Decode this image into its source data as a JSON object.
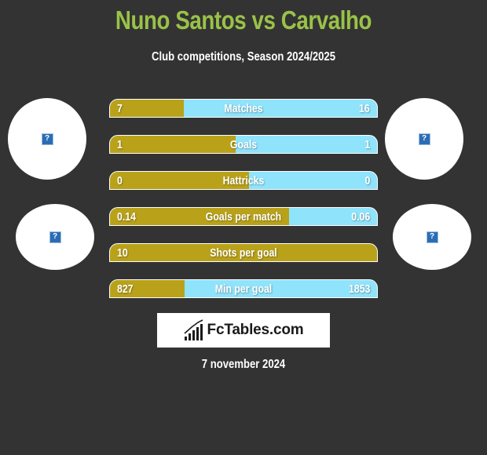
{
  "header": {
    "title": "Nuno Santos vs Carvalho",
    "subtitle": "Club competitions, Season 2024/2025"
  },
  "players": {
    "left": {
      "name": "Nuno Santos",
      "photo_icon": "broken-image-icon",
      "club_icon": "broken-image-icon"
    },
    "right": {
      "name": "Carvalho",
      "photo_icon": "broken-image-icon",
      "club_icon": "broken-image-icon"
    },
    "placeholder_glyph": "?"
  },
  "colors": {
    "background": "#333333",
    "title": "#9ac248",
    "left_bar": "#b9a21a",
    "right_bar": "#8fe3fb"
  },
  "stats": [
    {
      "label": "Matches",
      "left": "7",
      "right": "16",
      "left_share": 0.275
    },
    {
      "label": "Goals",
      "left": "1",
      "right": "1",
      "left_share": 0.47
    },
    {
      "label": "Hattricks",
      "left": "0",
      "right": "0",
      "left_share": 0.52
    },
    {
      "label": "Goals per match",
      "left": "0.14",
      "right": "0.06",
      "left_share": 0.67
    },
    {
      "label": "Shots per goal",
      "left": "10",
      "right": "",
      "left_share": 1.0
    },
    {
      "label": "Min per goal",
      "left": "827",
      "right": "1853",
      "left_share": 0.28
    }
  ],
  "footer": {
    "logo_text": "FcTables.com",
    "logo_icon": "bar-chart-icon",
    "date": "7 november 2024"
  }
}
